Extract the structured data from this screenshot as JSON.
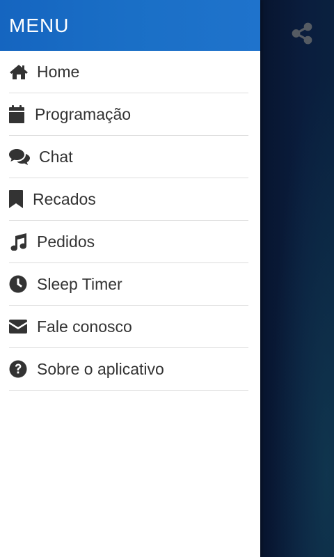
{
  "drawer": {
    "title": "MENU",
    "items": [
      {
        "label": "Home",
        "icon": "home-icon"
      },
      {
        "label": "Programação",
        "icon": "calendar-icon"
      },
      {
        "label": "Chat",
        "icon": "chat-icon"
      },
      {
        "label": "Recados",
        "icon": "bookmark-icon"
      },
      {
        "label": "Pedidos",
        "icon": "music-icon"
      },
      {
        "label": "Sleep Timer",
        "icon": "clock-icon"
      },
      {
        "label": "Fale conosco",
        "icon": "envelope-icon"
      },
      {
        "label": "Sobre o aplicativo",
        "icon": "question-circle-icon"
      }
    ]
  },
  "app": {
    "share_icon": "share-icon"
  },
  "colors": {
    "header_bg": "#1a6fc6",
    "text": "#333333",
    "divider": "#dcdcdc",
    "app_bg": "#0a1d3d"
  }
}
